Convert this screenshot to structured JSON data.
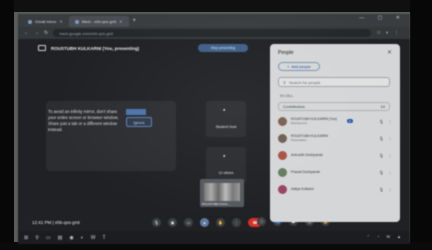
{
  "browser": {
    "tabs": [
      {
        "label": "Gmail Inbox",
        "active": false
      },
      {
        "label": "Meet - xhb-qxs-gmt",
        "active": true
      }
    ],
    "url": "meet.google.com/xhb-qxs-gmt",
    "window_controls": "— ▢ ✕"
  },
  "meet": {
    "presenting_label": "ROUSTUBH KULKARNI (You, presenting)",
    "stop_presenting": "Stop presenting",
    "share_message": "To avoid an infinity mirror, don't share your entire screen or browser window. Share just a tab or a different window instead.",
    "ignore_label": "Ignore",
    "tile_label_1": "Student Host",
    "tile_label_2": "12 others",
    "presenter_tile_label": "ROUSTUBH KULK...",
    "time_label": "12:41 PM | xhb-qxs-gmt"
  },
  "people": {
    "title": "People",
    "add_people": "Add people",
    "search_placeholder": "Search for people",
    "in_call_label": "IN CALL",
    "contributors_label": "Contributors",
    "contributors_count": "14",
    "participants": [
      {
        "name": "ROUSTUBH KULKARNI (You)",
        "sub": "Meeting host",
        "color": "#8a6d5a",
        "you": true
      },
      {
        "name": "ROUSTUBH KULKARNI",
        "sub": "Presentation",
        "color": "#7b6b60",
        "you": false
      },
      {
        "name": "Aniruddh Deshpande",
        "sub": "",
        "color": "#c15b4f",
        "you": false
      },
      {
        "name": "Prasad Deshpande",
        "sub": "",
        "color": "#6f8f6a",
        "you": false
      },
      {
        "name": "Aditya Kulkarni",
        "sub": "",
        "color": "#b04c6e",
        "you": false
      }
    ]
  },
  "colors": {
    "hangup": "#d93025",
    "accent": "#1a73e8"
  }
}
